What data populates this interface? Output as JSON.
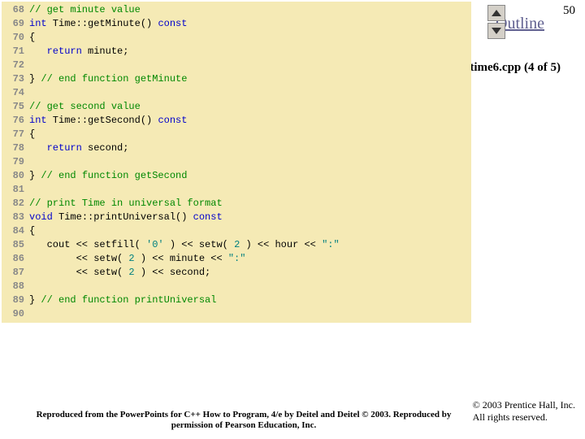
{
  "page_number": "50",
  "outline_label": "Outline",
  "filename_label": "time6.cpp (4 of 5)",
  "copyright_line1": "© 2003 Prentice Hall, Inc.",
  "copyright_line2": "All rights reserved.",
  "attribution": "Reproduced from the PowerPoints for C++ How to Program, 4/e by Deitel and Deitel © 2003. Reproduced by permission of Pearson Education, Inc.",
  "code": [
    {
      "n": "68",
      "segs": [
        {
          "c": "cm",
          "t": "// get minute value"
        }
      ]
    },
    {
      "n": "69",
      "segs": [
        {
          "c": "kw",
          "t": "int"
        },
        {
          "c": "id",
          "t": " Time::getMinute() "
        },
        {
          "c": "kw",
          "t": "const"
        }
      ]
    },
    {
      "n": "70",
      "segs": [
        {
          "c": "id",
          "t": "{"
        }
      ]
    },
    {
      "n": "71",
      "segs": [
        {
          "c": "id",
          "t": "   "
        },
        {
          "c": "kw",
          "t": "return"
        },
        {
          "c": "id",
          "t": " minute;"
        }
      ]
    },
    {
      "n": "72",
      "segs": []
    },
    {
      "n": "73",
      "segs": [
        {
          "c": "id",
          "t": "} "
        },
        {
          "c": "cm",
          "t": "// end function getMinute"
        }
      ]
    },
    {
      "n": "74",
      "segs": []
    },
    {
      "n": "75",
      "segs": [
        {
          "c": "cm",
          "t": "// get second value"
        }
      ]
    },
    {
      "n": "76",
      "segs": [
        {
          "c": "kw",
          "t": "int"
        },
        {
          "c": "id",
          "t": " Time::getSecond() "
        },
        {
          "c": "kw",
          "t": "const"
        }
      ]
    },
    {
      "n": "77",
      "segs": [
        {
          "c": "id",
          "t": "{"
        }
      ]
    },
    {
      "n": "78",
      "segs": [
        {
          "c": "id",
          "t": "   "
        },
        {
          "c": "kw",
          "t": "return"
        },
        {
          "c": "id",
          "t": " second;"
        }
      ]
    },
    {
      "n": "79",
      "segs": []
    },
    {
      "n": "80",
      "segs": [
        {
          "c": "id",
          "t": "} "
        },
        {
          "c": "cm",
          "t": "// end function getSecond"
        }
      ]
    },
    {
      "n": "81",
      "segs": []
    },
    {
      "n": "82",
      "segs": [
        {
          "c": "cm",
          "t": "// print Time in universal format"
        }
      ]
    },
    {
      "n": "83",
      "segs": [
        {
          "c": "kw",
          "t": "void"
        },
        {
          "c": "id",
          "t": " Time::printUniversal() "
        },
        {
          "c": "kw",
          "t": "const"
        }
      ]
    },
    {
      "n": "84",
      "segs": [
        {
          "c": "id",
          "t": "{"
        }
      ]
    },
    {
      "n": "85",
      "segs": [
        {
          "c": "id",
          "t": "   cout << setfill( "
        },
        {
          "c": "st",
          "t": "'0'"
        },
        {
          "c": "id",
          "t": " ) << setw( "
        },
        {
          "c": "st",
          "t": "2"
        },
        {
          "c": "id",
          "t": " ) << hour << "
        },
        {
          "c": "st",
          "t": "\":\""
        }
      ]
    },
    {
      "n": "86",
      "segs": [
        {
          "c": "id",
          "t": "        << setw( "
        },
        {
          "c": "st",
          "t": "2"
        },
        {
          "c": "id",
          "t": " ) << minute << "
        },
        {
          "c": "st",
          "t": "\":\""
        }
      ]
    },
    {
      "n": "87",
      "segs": [
        {
          "c": "id",
          "t": "        << setw( "
        },
        {
          "c": "st",
          "t": "2"
        },
        {
          "c": "id",
          "t": " ) << second;"
        }
      ]
    },
    {
      "n": "88",
      "segs": []
    },
    {
      "n": "89",
      "segs": [
        {
          "c": "id",
          "t": "} "
        },
        {
          "c": "cm",
          "t": "// end function printUniversal"
        }
      ]
    },
    {
      "n": "90",
      "segs": []
    }
  ]
}
